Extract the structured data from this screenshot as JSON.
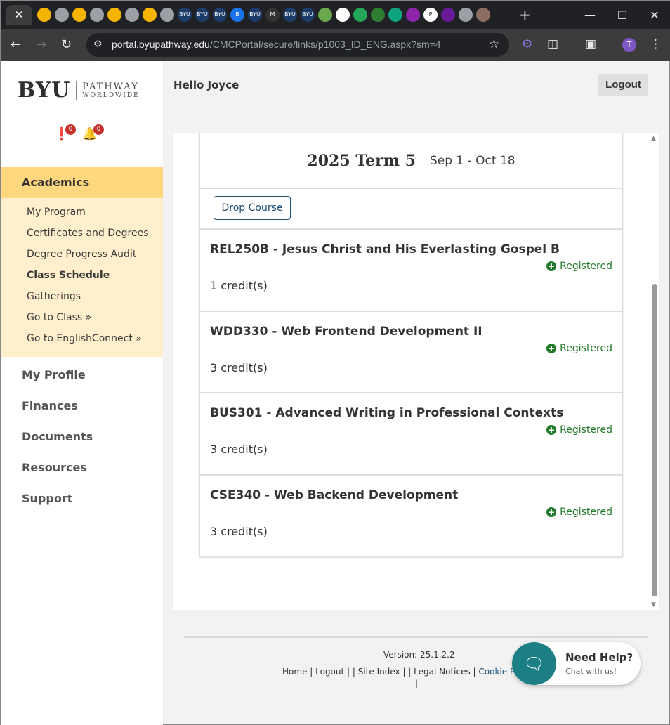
{
  "browser": {
    "close_tab_glyph": "✕",
    "new_tab_glyph": "+",
    "url_host": "portal.byupathway.edu",
    "url_path": "/CMCPortal/secure/links/p1003_ID_ENG.aspx?sm=4",
    "profile_initial": "T",
    "tab_icon_colors": [
      "#f5b400",
      "#9aa0a6",
      "#f5b400",
      "#9aa0a6",
      "#f5b400",
      "#9aa0a6",
      "#f5b400",
      "#9aa0a6",
      "#1d3c6a",
      "#1d3c6a",
      "#1d3c6a",
      "#1a73e8",
      "#1d3c6a",
      "#333333",
      "#1d3c6a",
      "#1d3c6a",
      "#6aa84f",
      "#ffffff",
      "#23a55a",
      "#2e7d32",
      "#10a37f",
      "#8e24aa",
      "#ffffff",
      "#6a1b9a",
      "#9aa0a6",
      "#8d6e63"
    ],
    "tab_icon_badges": [
      "",
      "",
      "",
      "",
      "",
      "",
      "",
      "",
      "BYU",
      "BYU",
      "BYU",
      "B",
      "BYU",
      "M",
      "BYU",
      "BYU",
      "",
      "",
      "",
      "",
      "",
      "",
      "P",
      "",
      "",
      ""
    ]
  },
  "sidebar": {
    "logo_byu": "BYU",
    "logo_line1": "PATHWAY",
    "logo_line2": "WORLDWIDE",
    "alerts_count": "0",
    "notifications_count": "0",
    "academics_label": "Academics",
    "sub_items": [
      {
        "label": "My Program"
      },
      {
        "label": "Certificates and Degrees"
      },
      {
        "label": "Degree Progress Audit"
      },
      {
        "label": "Class Schedule"
      },
      {
        "label": "Gatherings"
      },
      {
        "label": "Go to Class »"
      },
      {
        "label": "Go to EnglishConnect »"
      }
    ],
    "main_items": [
      {
        "label": "My Profile"
      },
      {
        "label": "Finances"
      },
      {
        "label": "Documents"
      },
      {
        "label": "Resources"
      },
      {
        "label": "Support"
      }
    ]
  },
  "header": {
    "greeting": "Hello Joyce",
    "logout_label": "Logout"
  },
  "schedule": {
    "term_title": "2025 Term 5",
    "term_dates": "Sep 1 - Oct 18",
    "drop_label": "Drop Course",
    "courses": [
      {
        "name": "REL250B - Jesus Christ and His Everlasting Gospel B",
        "credits": "1 credit(s)",
        "status": "Registered"
      },
      {
        "name": "WDD330 - Web Frontend Development II",
        "credits": "3 credit(s)",
        "status": "Registered"
      },
      {
        "name": "BUS301 - Advanced Writing in Professional Contexts",
        "credits": "3 credit(s)",
        "status": "Registered"
      },
      {
        "name": "CSE340 - Web Backend Development",
        "credits": "3 credit(s)",
        "status": "Registered"
      }
    ]
  },
  "footer": {
    "version": "Version: 25.1.2.2",
    "links": {
      "home": "Home",
      "logout": "Logout",
      "site_index": "Site Index",
      "legal": "Legal Notices",
      "cookie": "Cookie Pre",
      "sep1": " | ",
      "sep2": " | | ",
      "sep3": " | | ",
      "sep4": " | "
    },
    "trailing_bar": "|"
  },
  "help": {
    "title": "Need Help?",
    "subtitle": "Chat with us!"
  },
  "colors": {
    "academics_bg": "#ffd77e",
    "subnav_bg": "#ffefcc",
    "registered_green": "#237a2a",
    "primary_blue": "#1d4e74",
    "help_teal": "#1b7f85"
  }
}
